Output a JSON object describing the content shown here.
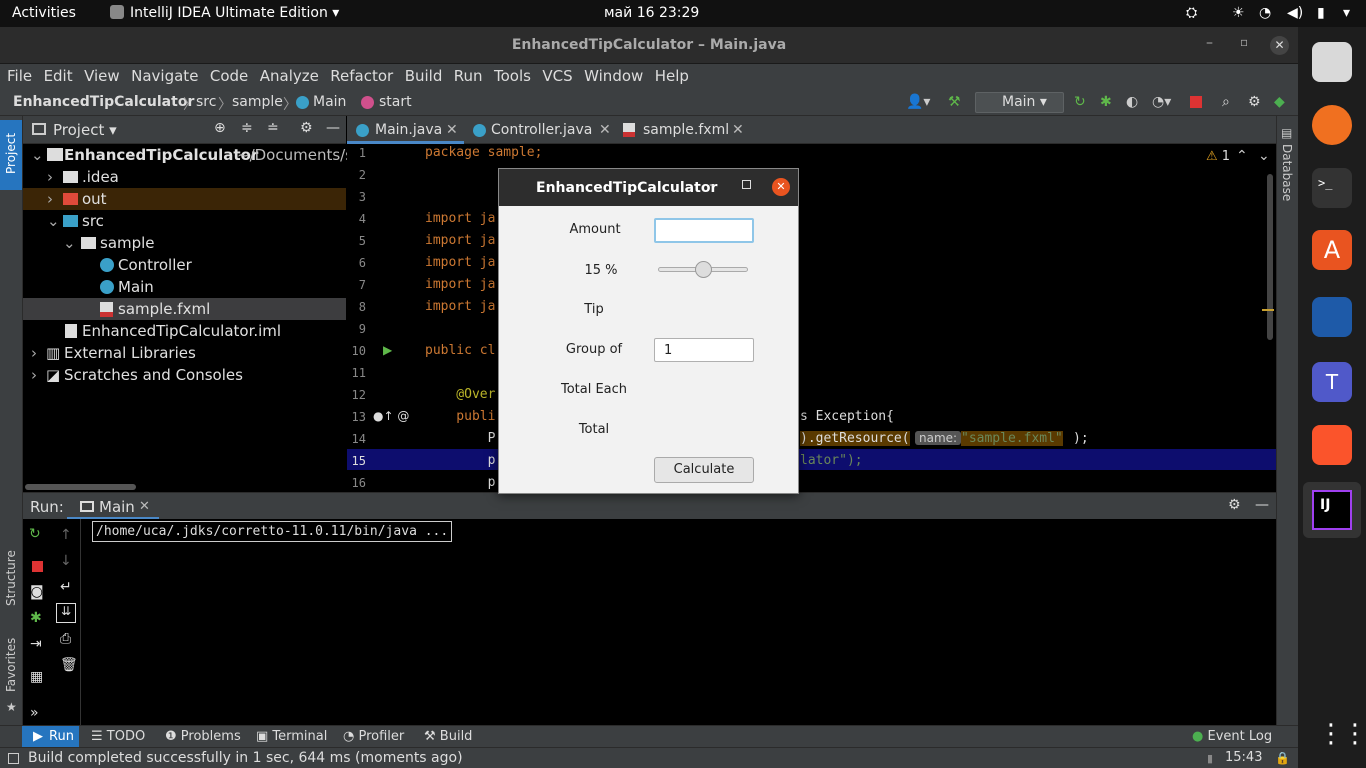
{
  "topbar": {
    "activities": "Activities",
    "app_name": "IntelliJ IDEA Ultimate Edition",
    "clock": "май 16  23:29"
  },
  "window": {
    "title": "EnhancedTipCalculator – Main.java"
  },
  "menu": [
    "File",
    "Edit",
    "View",
    "Navigate",
    "Code",
    "Analyze",
    "Refactor",
    "Build",
    "Run",
    "Tools",
    "VCS",
    "Window",
    "Help"
  ],
  "breadcrumb": {
    "project": "EnhancedTipCalculator",
    "src": "src",
    "pkg": "sample",
    "cls": "Main",
    "method": "start",
    "run_config": "Main"
  },
  "project_panel": {
    "title": "Project",
    "side_tab": "Project",
    "root": "EnhancedTipCalculator",
    "root_path": "~/Documents/su",
    "items": [
      "EnhancedTipCalculator",
      ".idea",
      "out",
      "src",
      "sample",
      "Controller",
      "Main",
      "sample.fxml",
      "EnhancedTipCalculator.iml",
      "External Libraries",
      "Scratches and Consoles"
    ]
  },
  "editor": {
    "tabs": [
      "Main.java",
      "Controller.java",
      "sample.fxml"
    ],
    "warnings": "1",
    "lines": [
      {
        "n": "1",
        "t": "package sample;"
      },
      {
        "n": "2",
        "t": ""
      },
      {
        "n": "3",
        "t": ""
      },
      {
        "n": "4",
        "t": "import ja"
      },
      {
        "n": "5",
        "t": "import ja"
      },
      {
        "n": "6",
        "t": "import ja"
      },
      {
        "n": "7",
        "t": "import ja"
      },
      {
        "n": "8",
        "t": "import ja"
      },
      {
        "n": "9",
        "t": ""
      },
      {
        "n": "10",
        "t": "public cl"
      },
      {
        "n": "11",
        "t": ""
      },
      {
        "n": "12",
        "t": "    @Over"
      },
      {
        "n": "13",
        "t": "    publi"
      },
      {
        "n": "14",
        "t": "        P"
      },
      {
        "n": "15",
        "t": "        p"
      },
      {
        "n": "16",
        "t": "        p"
      }
    ],
    "line13_tail": "s Exception{",
    "line14_tail_a": ").getResource(",
    "line14_hint": "name:",
    "line14_str": "\"sample.fxml\"",
    "line14_end": ");",
    "line15_tail": "lator\");"
  },
  "dialog": {
    "title": "EnhancedTipCalculator",
    "amount_label": "Amount",
    "amount_value": "",
    "percent_label": "15 %",
    "slider_value_percent": 15,
    "tip_label": "Tip",
    "group_label": "Group of",
    "group_value": "1",
    "total_each_label": "Total Each",
    "total_label": "Total",
    "calculate_label": "Calculate"
  },
  "run_panel": {
    "label": "Run:",
    "tab": "Main",
    "output": "/home/uca/.jdks/corretto-11.0.11/bin/java ..."
  },
  "side_tabs": {
    "structure": "Structure",
    "favorites": "Favorites",
    "database": "Database"
  },
  "bottom_tabs": [
    "Run",
    "TODO",
    "Problems",
    "Terminal",
    "Profiler",
    "Build"
  ],
  "event_log": "Event Log",
  "status": {
    "message": "Build completed successfully in 1 sec, 644 ms (moments ago)",
    "time": "15:43"
  },
  "colors": {
    "accent": "#2675bf",
    "selected_line": "#0d0d6e",
    "ide_bg": "#3c3f41"
  }
}
